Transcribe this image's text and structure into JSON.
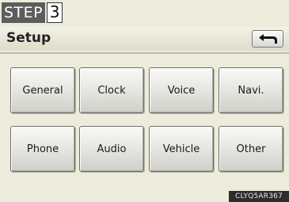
{
  "step": {
    "label": "STEP",
    "number": "3"
  },
  "header": {
    "title": "Setup",
    "back_icon": "return-arrow-icon"
  },
  "menu": {
    "items": [
      {
        "label": "General"
      },
      {
        "label": "Clock"
      },
      {
        "label": "Voice"
      },
      {
        "label": "Navi."
      },
      {
        "label": "Phone"
      },
      {
        "label": "Audio"
      },
      {
        "label": "Vehicle"
      },
      {
        "label": "Other"
      }
    ]
  },
  "footer": {
    "code": "CLYQ5AR367"
  },
  "colors": {
    "screen_bg": "#ecebdc",
    "badge_bg": "#5d5d5d",
    "footer_bg": "#2d2d2d"
  }
}
